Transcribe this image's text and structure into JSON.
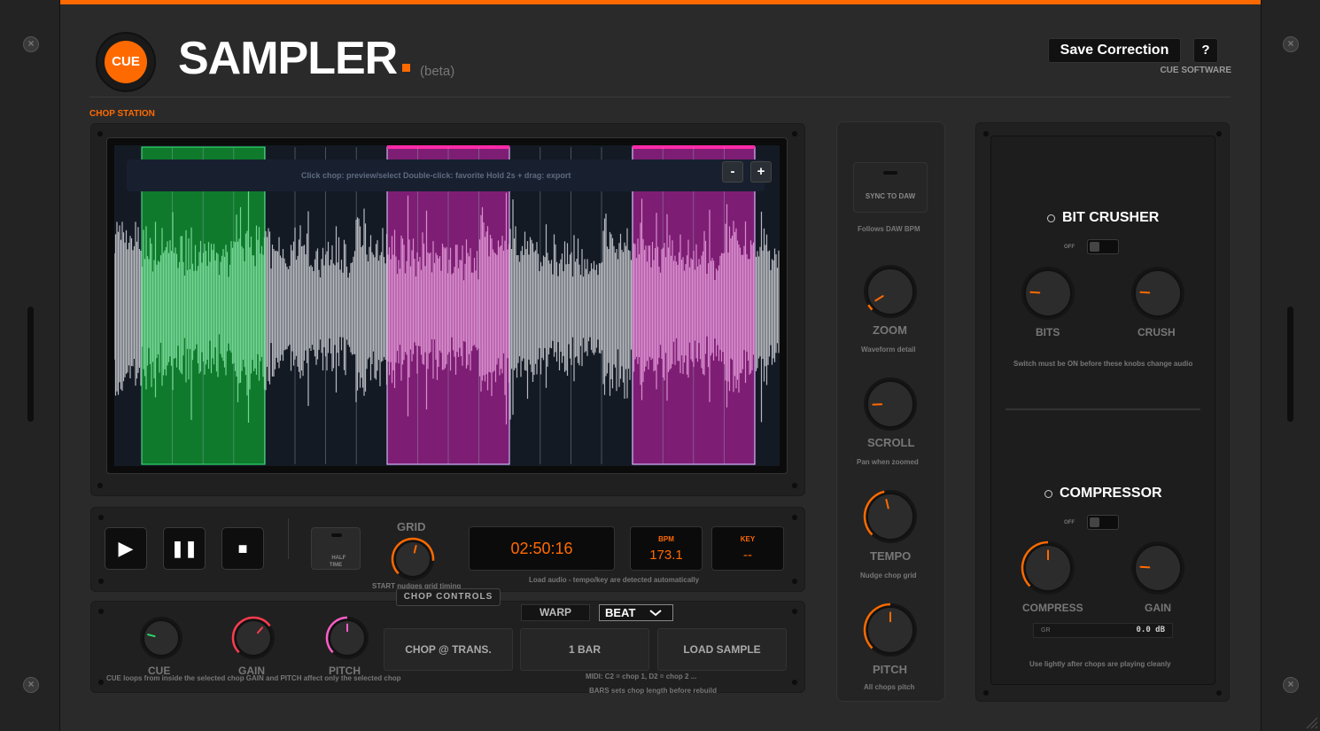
{
  "app": {
    "logo": "CUE",
    "title": "SAMPLER",
    "badge": "(beta)",
    "brand": "CUE SOFTWARE"
  },
  "header": {
    "save_label": "Save Correction",
    "help_label": "?"
  },
  "section": "CHOP STATION",
  "waveform": {
    "hint": "Click chop: preview/select    Double-click: favorite    Hold 2s + drag: export",
    "zoom_out": "-",
    "zoom_in": "+",
    "chop_colors": {
      "favorite": "#0f7a2c",
      "selected": "#7d1e74",
      "marker_top": "#ff2aa8"
    }
  },
  "transport": {
    "play": "▶",
    "pause": "❚❚",
    "stop": "■",
    "half_time": "HALF\nTIME",
    "grid_label": "GRID",
    "grid_caption": "START nudges grid timing"
  },
  "display": {
    "time": "02:50:16",
    "bpm_label": "BPM",
    "bpm": "173.1",
    "key_label": "KEY",
    "key": "--",
    "caption": "Load audio - tempo/key are detected automatically"
  },
  "chop_controls": {
    "label": "CHOP CONTROLS",
    "cue_label": "CUE",
    "gain_label": "GAIN",
    "pitch_label": "PITCH",
    "caption": "CUE loops from inside the selected chop   GAIN and PITCH affect only the selected chop",
    "warp": "WARP",
    "beat": "BEAT",
    "chop_trans": "CHOP @ TRANS.",
    "bar": "1 BAR",
    "load": "LOAD SAMPLE",
    "midi_note": "MIDI: C2 = chop 1,  D2 = chop 2 ...",
    "bars_note": "BARS sets chop length before rebuild"
  },
  "side": {
    "sync": "SYNC TO DAW",
    "sync_caption": "Follows DAW BPM",
    "zoom": "ZOOM",
    "zoom_caption": "Waveform detail",
    "scroll": "SCROLL",
    "scroll_caption": "Pan when zoomed",
    "tempo": "TEMPO",
    "tempo_caption": "Nudge chop grid",
    "pitch": "PITCH",
    "pitch_caption": "All chops pitch"
  },
  "fx": {
    "bitcrusher": {
      "title": "BIT CRUSHER",
      "off": "OFF",
      "bits": "BITS",
      "crush": "CRUSH",
      "caption": "Switch must be ON before these knobs change audio"
    },
    "compressor": {
      "title": "COMPRESSOR",
      "off": "OFF",
      "compress": "COMPRESS",
      "gain": "GAIN",
      "gr_label": "GR",
      "gr_value": "0.0 dB",
      "caption": "Use lightly after chops are playing cleanly"
    }
  },
  "colors": {
    "accent": "#ff6a00",
    "pink": "#ff5d8f",
    "green": "#2bd96a"
  }
}
